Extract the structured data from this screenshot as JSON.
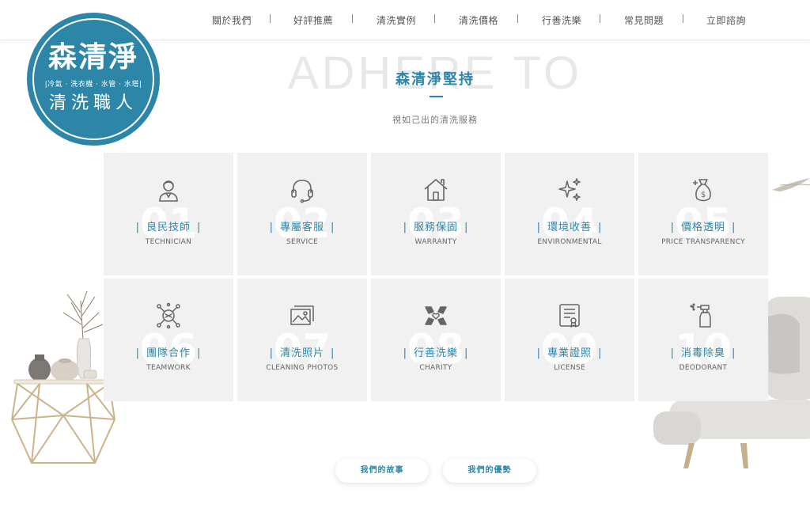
{
  "nav": {
    "items": [
      "關於我們",
      "好評推薦",
      "清洗實例",
      "清洗價格",
      "行善洗樂",
      "常見問題",
      "立即諮詢"
    ]
  },
  "logo": {
    "title": "森清淨",
    "tagline": "|冷氣 · 洗衣機 · 水管 · 水塔|",
    "subtitle": "清洗職人"
  },
  "section": {
    "watermark": "ADHERE TO",
    "title": "森清淨堅持",
    "subtitle": "視如己出的清洗服務"
  },
  "tiles": [
    {
      "num": "01",
      "title": "良民技師",
      "en": "TECHNICIAN",
      "icon": "technician-icon"
    },
    {
      "num": "02",
      "title": "專屬客服",
      "en": "SERVICE",
      "icon": "headset-icon"
    },
    {
      "num": "03",
      "title": "服務保固",
      "en": "WARRANTY",
      "icon": "house-icon"
    },
    {
      "num": "04",
      "title": "環境收善",
      "en": "ENVIRONMENTAL",
      "icon": "sparkle-icon"
    },
    {
      "num": "05",
      "title": "價格透明",
      "en": "PRICE TRANSPARENCY",
      "icon": "money-bag-icon"
    },
    {
      "num": "06",
      "title": "團隊合作",
      "en": "TEAMWORK",
      "icon": "teamwork-icon"
    },
    {
      "num": "07",
      "title": "清洗照片",
      "en": "CLEANING PHOTOS",
      "icon": "photos-icon"
    },
    {
      "num": "08",
      "title": "行善洗樂",
      "en": "CHARITY",
      "icon": "charity-icon"
    },
    {
      "num": "09",
      "title": "專業證照",
      "en": "LICENSE",
      "icon": "certificate-icon"
    },
    {
      "num": "10",
      "title": "消毒除臭",
      "en": "DEODORANT",
      "icon": "spray-bottle-icon"
    }
  ],
  "buttons": {
    "story": "我們的故事",
    "advantage": "我們的優勢"
  },
  "colors": {
    "accent": "#2d86a8",
    "tile_bg": "#f1f1f1"
  }
}
